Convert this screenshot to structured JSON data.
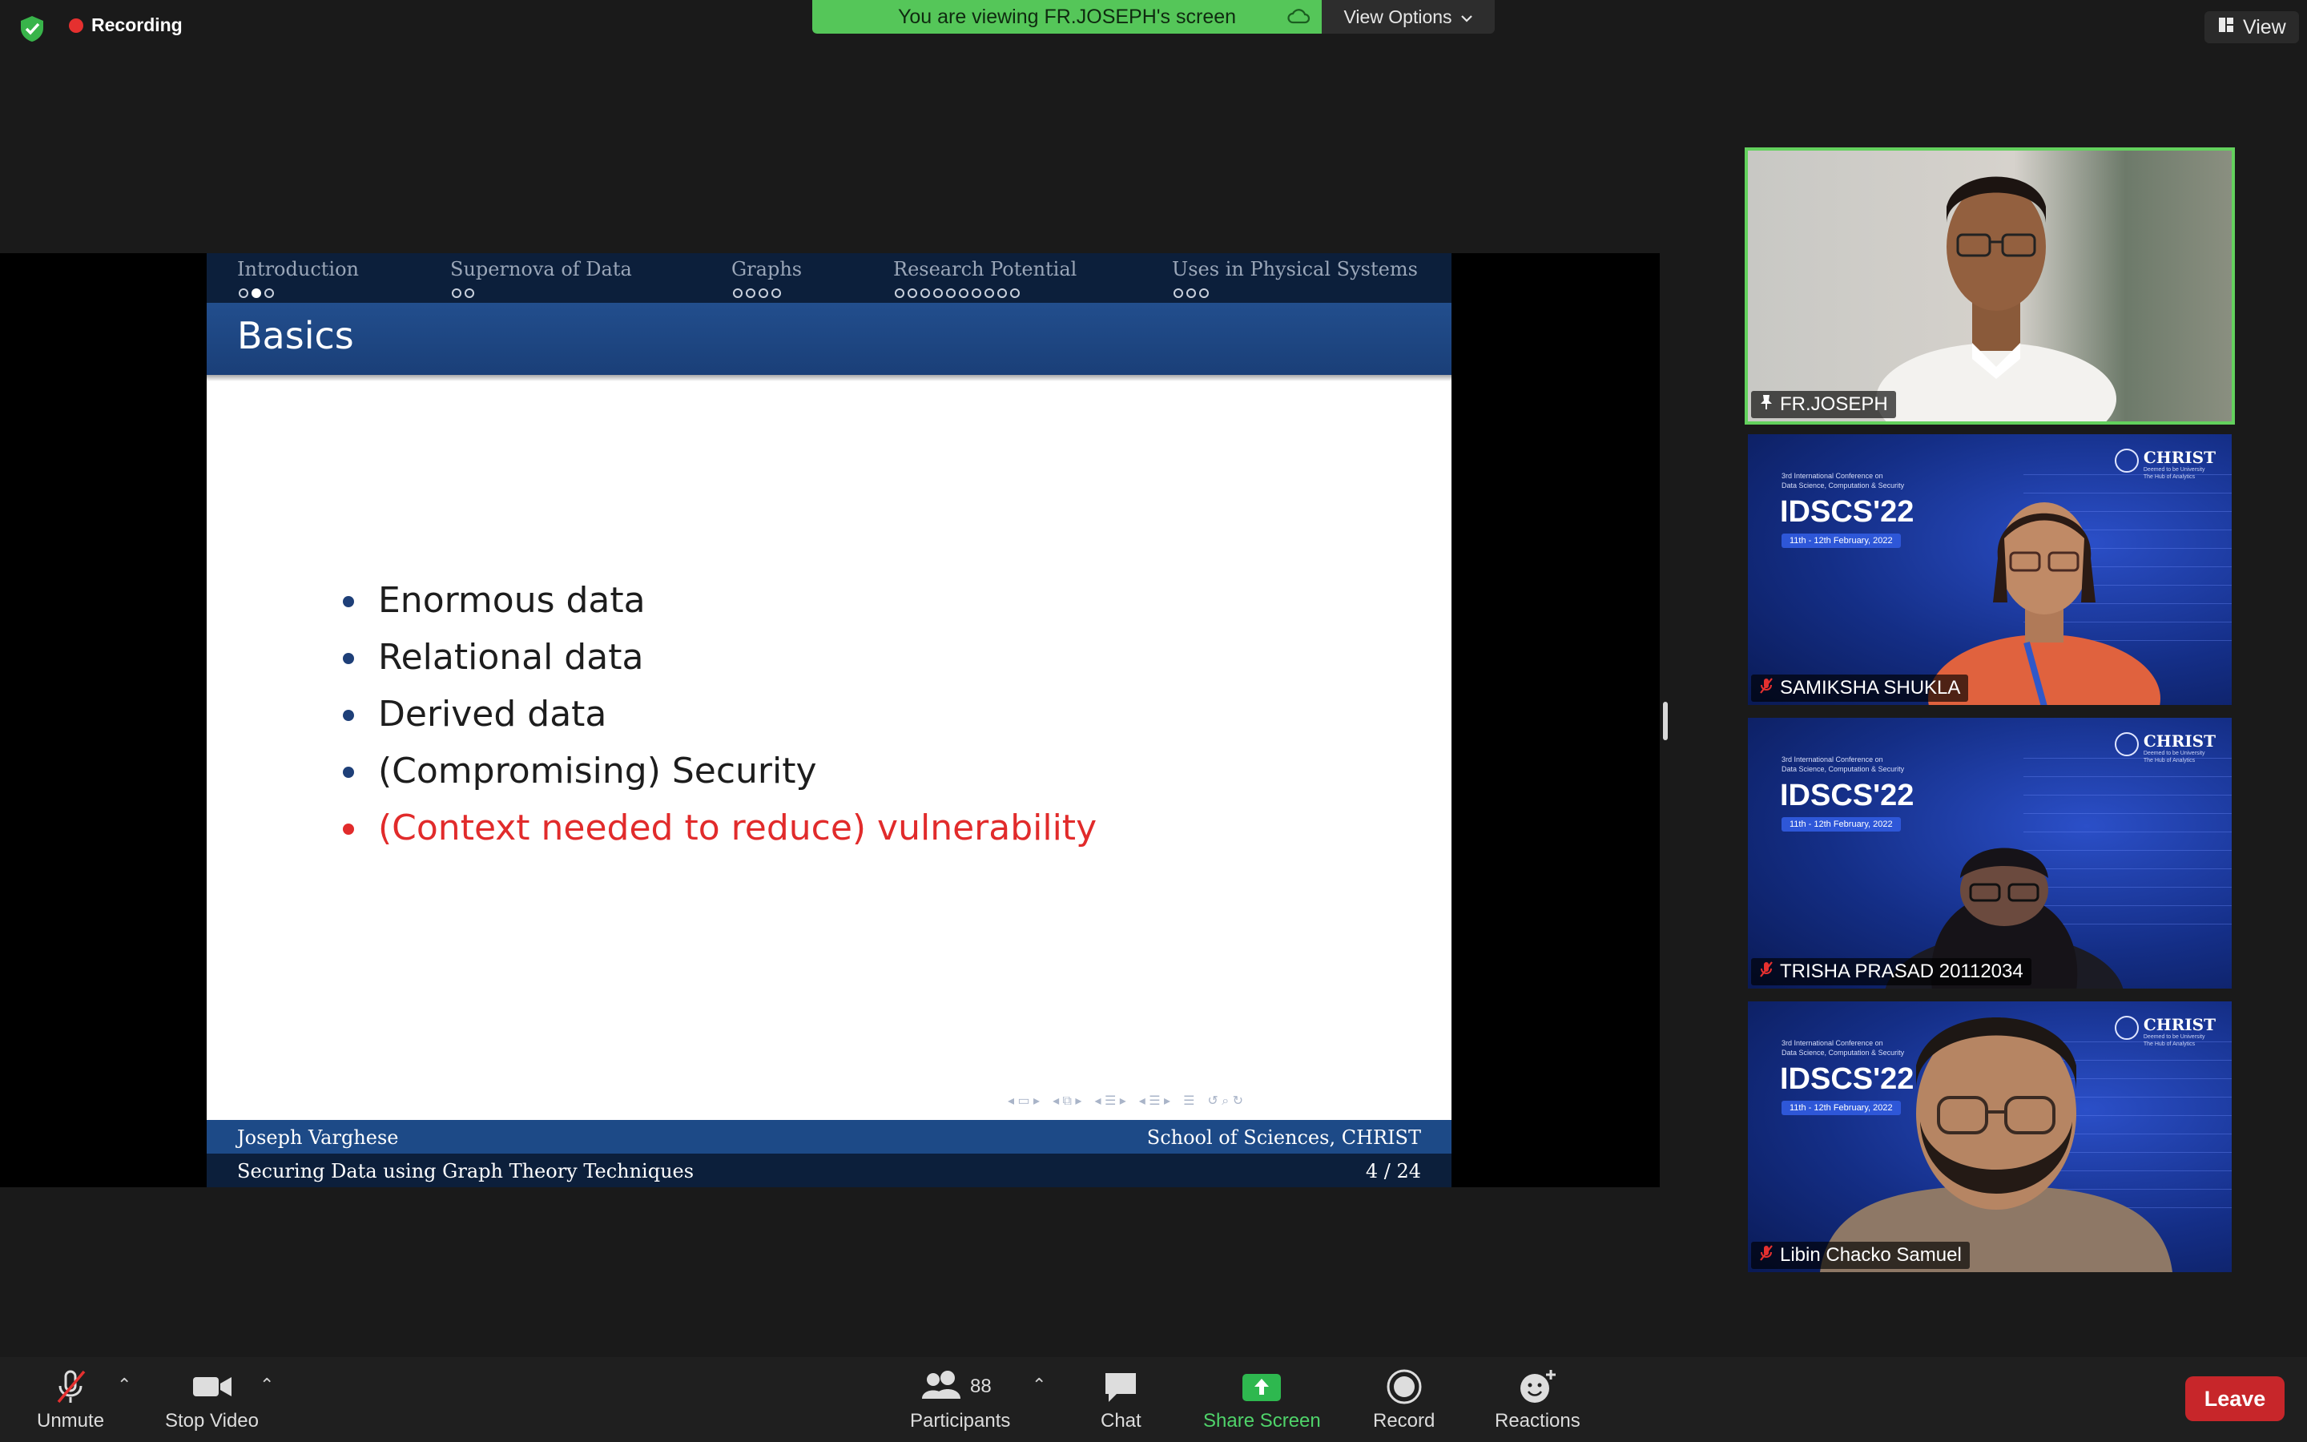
{
  "top_bar": {
    "recording_label": "Recording",
    "banner_text": "You are viewing FR.JOSEPH's screen",
    "view_options_label": "View Options",
    "view_label": "View"
  },
  "slide": {
    "nav_sections": [
      {
        "label": "Introduction",
        "dots": 3,
        "filled": [
          1
        ],
        "active": true
      },
      {
        "label": "Supernova of Data",
        "dots": 2,
        "filled": [],
        "active": false
      },
      {
        "label": "Graphs",
        "dots": 4,
        "filled": [],
        "active": false
      },
      {
        "label": "Research Potential",
        "dots": 10,
        "filled": [],
        "active": false
      },
      {
        "label": "Uses in Physical Systems",
        "dots": 3,
        "filled": [],
        "active": false
      }
    ],
    "title": "Basics",
    "bullets": [
      "Enormous data",
      "Relational data",
      "Derived data",
      "(Compromising) Security",
      "(Context needed to reduce) vulnerability"
    ],
    "footer": {
      "author": "Joseph Varghese",
      "institute": "School of Sciences, CHRIST",
      "talk_title": "Securing Data using Graph Theory Techniques",
      "page": "4 / 24"
    }
  },
  "participants": [
    {
      "name": "FR.JOSEPH",
      "tag_icon": "pin-icon",
      "active_speaker": true
    },
    {
      "name": "SAMIKSHA SHUKLA",
      "tag_icon": "mic-muted-icon",
      "active_speaker": false
    },
    {
      "name": "TRISHA PRASAD 20112034",
      "tag_icon": "mic-muted-icon",
      "active_speaker": false
    },
    {
      "name": "Libin Chacko Samuel",
      "tag_icon": "mic-muted-icon",
      "active_speaker": false
    }
  ],
  "virtual_background": {
    "conference_line1": "3rd International Conference on",
    "conference_line2": "Data Science, Computation & Security",
    "title": "IDSCS'22",
    "dates": "11th - 12th February, 2022",
    "university": "CHRIST",
    "university_sub1": "Deemed to be University",
    "university_sub2": "The Hub of Analytics"
  },
  "toolbar": {
    "unmute": "Unmute",
    "stop_video": "Stop Video",
    "participants": "Participants",
    "participants_count": "88",
    "chat": "Chat",
    "share_screen": "Share Screen",
    "record": "Record",
    "reactions": "Reactions",
    "leave": "Leave"
  },
  "colors": {
    "banner_green": "#55c659",
    "active_speaker_border": "#63d15d",
    "leave_red": "#c7262a",
    "slide_navy": "#0c1f3b",
    "slide_blue": "#1d4a87",
    "alert_red": "#e12b2b"
  }
}
